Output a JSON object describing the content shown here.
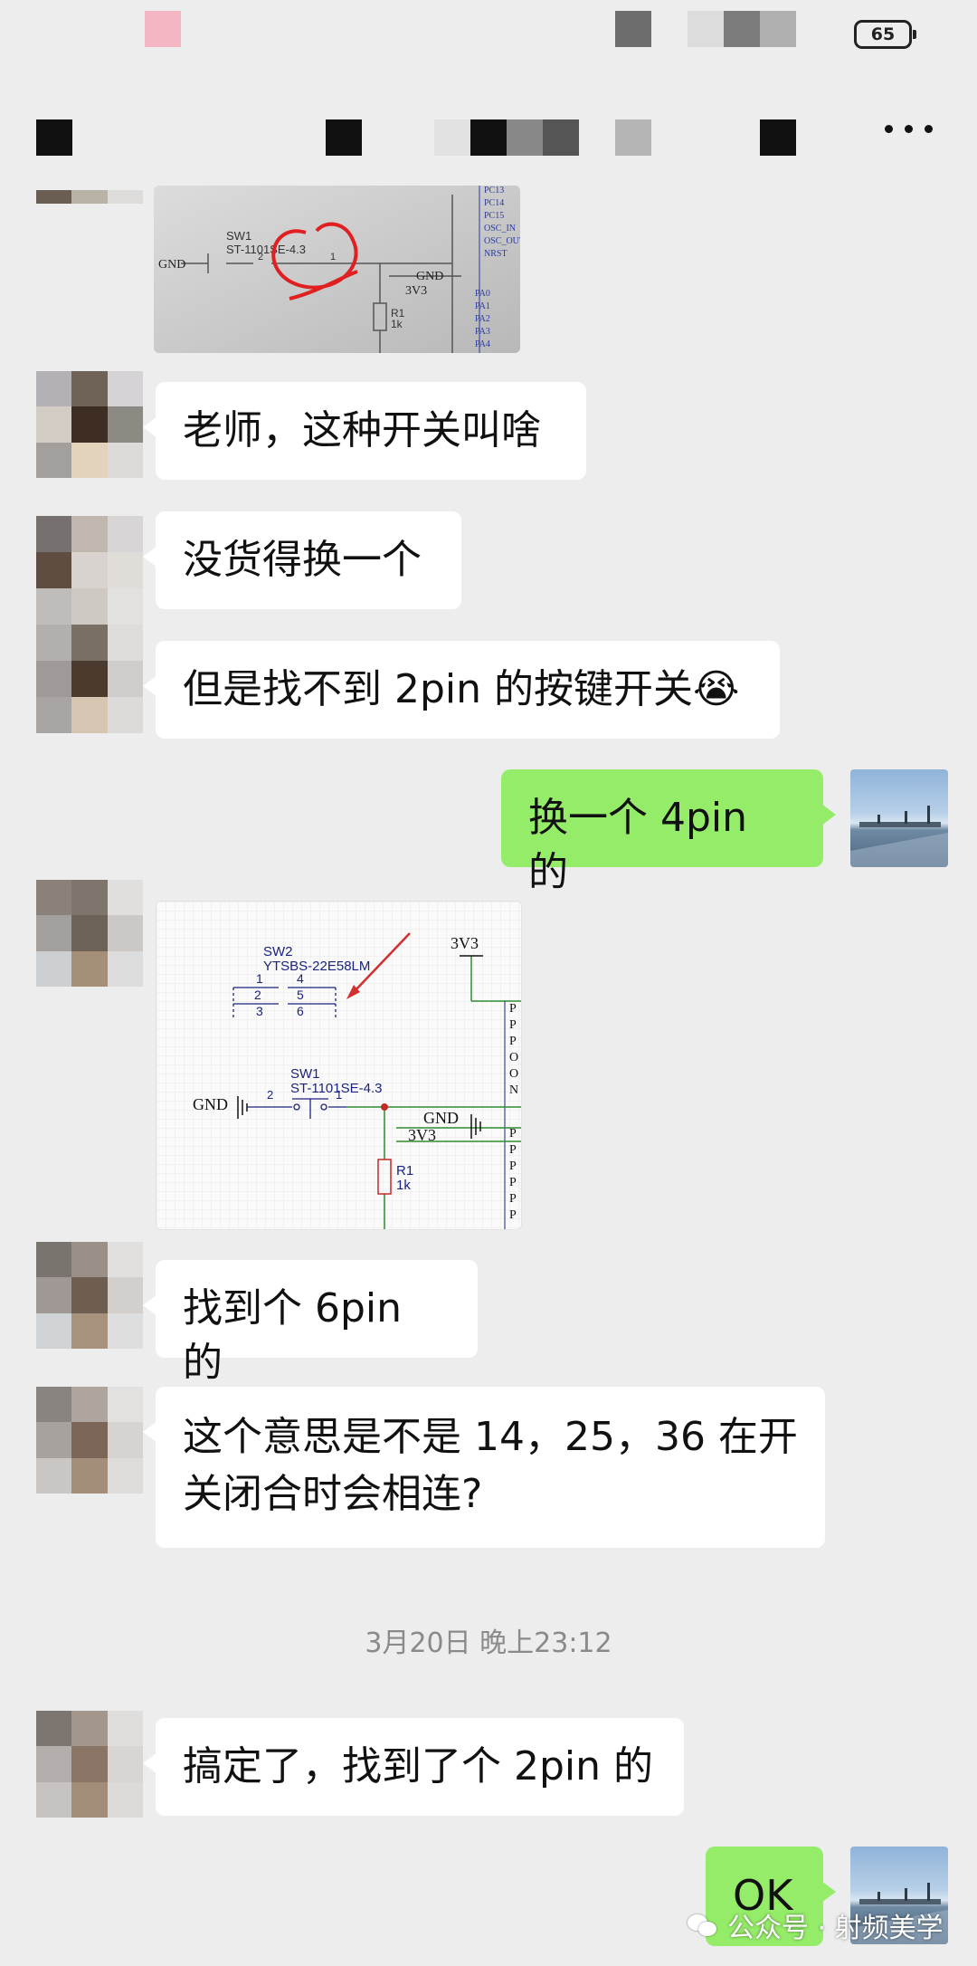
{
  "status_bar": {
    "battery": "65"
  },
  "messages": [
    {
      "id": "m1",
      "sender": "other",
      "type": "image"
    },
    {
      "id": "m2",
      "sender": "other",
      "type": "text",
      "text": "老师，这种开关叫啥"
    },
    {
      "id": "m3",
      "sender": "other",
      "type": "text",
      "text": "没货得换一个"
    },
    {
      "id": "m4",
      "sender": "other",
      "type": "text",
      "text": "但是找不到 2pin 的按键开关",
      "emoji": "😭"
    },
    {
      "id": "m5",
      "sender": "me",
      "type": "text",
      "text": "换一个 4pin 的"
    },
    {
      "id": "m6",
      "sender": "other",
      "type": "image"
    },
    {
      "id": "m7",
      "sender": "other",
      "type": "text",
      "text": "找到个 6pin 的"
    },
    {
      "id": "m8",
      "sender": "other",
      "type": "text",
      "lines": [
        "这个意思是不是 14，25，36 在开",
        "关闭合时会相连?"
      ]
    },
    {
      "id": "m9",
      "sender": "other",
      "type": "text",
      "text": "搞定了，找到了个 2pin 的"
    },
    {
      "id": "m10",
      "sender": "me",
      "type": "text",
      "text": "OK"
    }
  ],
  "timestamp": "3月20日 晚上23:12",
  "schematic_top": {
    "labels": [
      "SW1",
      "ST-1101SE-4.3",
      "GND",
      "GND",
      "3V3",
      "R1",
      "1k",
      "2",
      "1"
    ],
    "pins": [
      "PC13",
      "PC14",
      "PC15",
      "OSC_IN",
      "OSC_OUT",
      "NRST",
      "PA0",
      "PA1",
      "PA2",
      "PA3",
      "PA4"
    ]
  },
  "schematic_main": {
    "sw2_label": "SW2",
    "sw2_part": "YTSBS-22E58LM",
    "sw2_pins": [
      "1",
      "2",
      "3",
      "4",
      "5",
      "6"
    ],
    "sw1_label": "SW1",
    "sw1_part": "ST-1101SE-4.3",
    "gnd1": "GND",
    "gnd2": "GND",
    "vcc1": "3V3",
    "vcc2": "3V3",
    "r1": "R1",
    "r1_val": "1k",
    "pin_a": "2",
    "pin_b": "1",
    "right_pins": [
      "P",
      "P",
      "P",
      "O",
      "O",
      "N",
      "P",
      "P",
      "P",
      "P",
      "P",
      "P"
    ]
  },
  "watermark": "公众号 · 射频美学",
  "colors": {
    "background": "#ededed",
    "bubble_other": "#ffffff",
    "bubble_me": "#95ec69",
    "wire": "#2e8b2e",
    "annotation": "#e02020"
  }
}
